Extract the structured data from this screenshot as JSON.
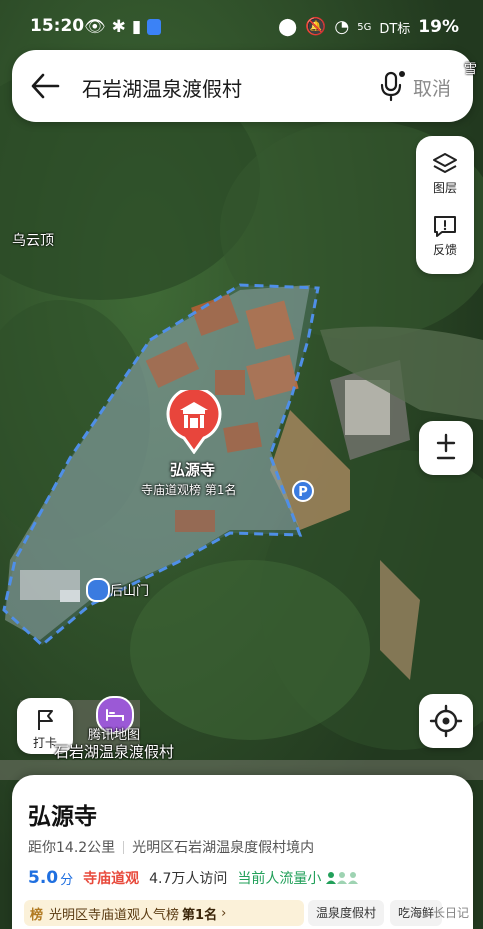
{
  "status_bar": {
    "time": "15:20",
    "battery": "19%",
    "network": "5G",
    "carrier_overlay": "DT标"
  },
  "search": {
    "query": "石岩湖温泉渡假村",
    "cancel_label": "取消"
  },
  "map_controls": {
    "layers_label": "图层",
    "feedback_label": "反馈",
    "checkin_label": "打卡"
  },
  "map_labels": {
    "wuyunding": "乌云顶",
    "houshanmen": "后山门",
    "provider": "腾讯地图",
    "resort": "石岩湖温泉渡假村",
    "corner_text": "雪"
  },
  "pin": {
    "name": "弘源寺",
    "rank": "寺庙道观榜 第1名"
  },
  "poi_card": {
    "title": "弘源寺",
    "distance": "距你14.2公里",
    "location": "光明区石岩湖温泉度假村境内",
    "score": "5.0",
    "score_unit": "分",
    "category": "寺庙道观",
    "visits": "4.7万人访问",
    "crowd": "当前人流量小",
    "ranking_badge": "榜",
    "ranking_text": "光明区寺庙道观人气榜",
    "ranking_position": "第1名",
    "tags": [
      "温泉度假村",
      "吃海鲜"
    ]
  },
  "watermark": "长日记",
  "colors": {
    "accent_blue": "#1f6fe0",
    "temple_red": "#e84a3c",
    "crowd_green": "#22a05a",
    "boundary_blue": "#4f8fe8"
  }
}
